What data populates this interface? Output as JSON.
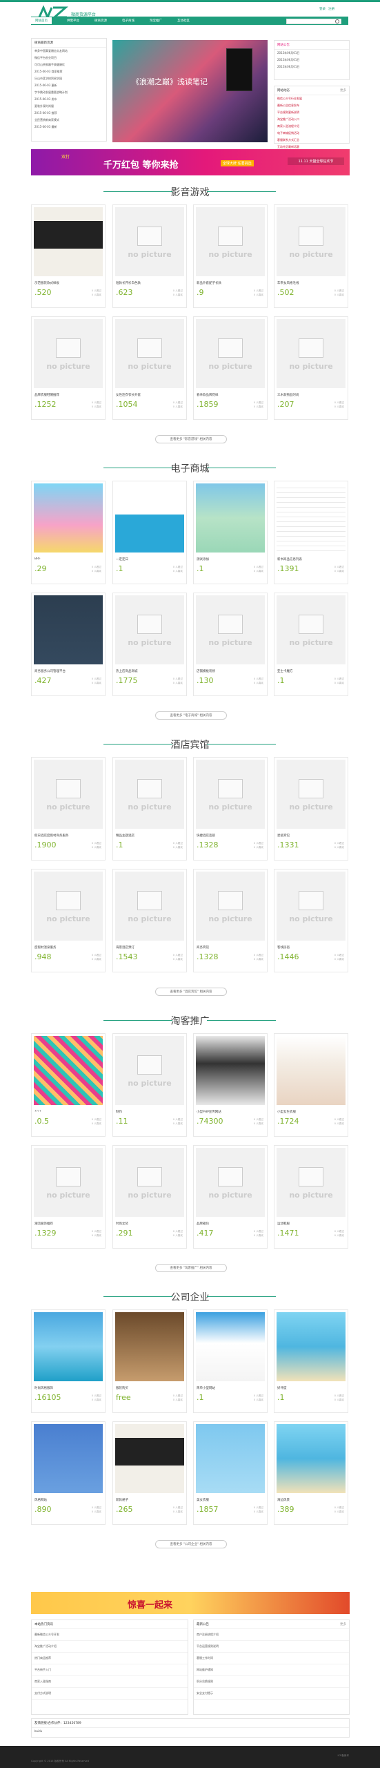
{
  "colors": {
    "brand": "#1e9e7c",
    "price": "#7fb32e",
    "promo_magenta": "#e4197a"
  },
  "header": {
    "logo_text": "微商货源平台",
    "login_label": "登录",
    "register_label": "注册"
  },
  "nav": {
    "items": [
      "网站首页",
      "供需平台",
      "微商货源",
      "电子商城",
      "淘宝推广",
      "互动社区"
    ],
    "active_index": 0,
    "search_placeholder": ""
  },
  "left_news": {
    "title": "微商最新货源",
    "items": [
      {
        "t": "单身中国真爱婚恋交友网站",
        "d": "2015-06-03"
      },
      {
        "t": "微信平台创业项目",
        "d": "2015-06-03"
      },
      {
        "t": "可可山茶鲜嫩手表健康饮",
        "d": "2015-06-03"
      },
      {
        "t": "2015-06-03 商家推荐",
        "d": "2015-06-03"
      },
      {
        "t": "乐山市某学校贸易学园",
        "d": "2015-06-03"
      },
      {
        "t": "2015-06-03 更新",
        "d": "2015-06-03"
      },
      {
        "t": "字节跳动发展重要战略计划",
        "d": "2015-06-03"
      },
      {
        "t": "2015-06-03 发布",
        "d": "2015-06-03"
      },
      {
        "t": "夏装外观时尚服",
        "d": "2015-06-03"
      },
      {
        "t": "2015-06-03 推荐",
        "d": "2015-06-03"
      },
      {
        "t": "全民营销新商家模式",
        "d": "2015-06-03"
      },
      {
        "t": "2015-06-03 最新",
        "d": "2015-06-03"
      }
    ]
  },
  "banner": {
    "text": "《浪潮之巅》浅读笔记"
  },
  "right_top": {
    "title": "网站公告",
    "items": [
      "2015年06月01日",
      "2015年06月01日",
      "2015年06月01日"
    ]
  },
  "right_list": {
    "title": "网站动态",
    "more": "更多",
    "items": [
      "微信公众号行业发展",
      "最新公告信息发布",
      "平台规则更新说明",
      "淘宝推广活动入口",
      "商家入驻流程介绍",
      "电子商城促销活动",
      "客服联系方式汇总",
      "互动社区最新话题"
    ]
  },
  "promo": {
    "left_tag": "双打",
    "main": "千万红包 等你来抢",
    "sub": "全球大牌 任君挑选",
    "right": "11.11 天猫全球狂欢节"
  },
  "sections": [
    {
      "title": "影音游戏",
      "more": "查看更多 \"影音游戏\" 相关内容",
      "rows": [
        [
          {
            "name": "示范服装款式样板",
            "price": ".520",
            "s1": "0 人看过",
            "s2": "0 人喜欢",
            "pic": "dress"
          },
          {
            "name": "短款长开衫白色款",
            "price": ".623",
            "s1": "0 人看过",
            "s2": "0 人喜欢",
            "pic": "none"
          },
          {
            "name": "新品外套配子长款",
            "price": ".9",
            "s1": "0 人看过",
            "s2": "0 人喜欢",
            "pic": "none"
          },
          {
            "name": "车帝女风格毛线",
            "price": ".502",
            "s1": "0 人看过",
            "s2": "0 人喜欢",
            "pic": "none"
          }
        ],
        [
          {
            "name": "品牌衣服鞋帽推荐",
            "price": ".1252",
            "s1": "0 人看过",
            "s2": "0 人喜欢",
            "pic": "none"
          },
          {
            "name": "女性连衣衣长外套",
            "price": ".1054",
            "s1": "0 人看过",
            "s2": "0 人喜欢",
            "pic": "none"
          },
          {
            "name": "春季款品牌花样",
            "price": ".1859",
            "s1": "0 人看过",
            "s2": "0 人喜欢",
            "pic": "none"
          },
          {
            "name": "三木款物品时尚",
            "price": ".207",
            "s1": "0 人看过",
            "s2": "0 人喜欢",
            "pic": "none"
          }
        ]
      ]
    },
    {
      "title": "电子商城",
      "more": "查看更多 \"电子商城\" 相关内容",
      "rows": [
        [
          {
            "name": "BRF",
            "price": ".29",
            "s1": "0 人看过",
            "s2": "0 人喜欢",
            "pic": "cartoon"
          },
          {
            "name": "一定定日",
            "price": ".1",
            "s1": "0 人看过",
            "s2": "0 人喜欢",
            "pic": "logo"
          },
          {
            "name": "测试添加",
            "price": ".1",
            "s1": "0 人看过",
            "s2": "0 人喜欢",
            "pic": "woman"
          },
          {
            "name": "新书商品信息列表",
            "price": ".1391",
            "s1": "0 人看过",
            "s2": "0 人喜欢",
            "pic": "list"
          }
        ],
        [
          {
            "name": "商务服务公司管理平台",
            "price": ".427",
            "s1": "0 人看过",
            "s2": "0 人喜欢",
            "pic": "web"
          },
          {
            "name": "热上店商品商城",
            "price": ".1775",
            "s1": "0 人看过",
            "s2": "0 人喜欢",
            "pic": "none"
          },
          {
            "name": "店铺模板装修",
            "price": ".130",
            "s1": "0 人看过",
            "s2": "0 人喜欢",
            "pic": "none"
          },
          {
            "name": "亚士卡魔方",
            "price": ".1",
            "s1": "0 人看过",
            "s2": "0 人喜欢",
            "pic": "none"
          }
        ]
      ]
    },
    {
      "title": "酒店宾馆",
      "more": "查看更多 \"酒店宾馆\" 相关内容",
      "rows": [
        [
          {
            "name": "假日酒店度假村商务服务",
            "price": ".1900",
            "s1": "0 人看过",
            "s2": "0 人喜欢",
            "pic": "none"
          },
          {
            "name": "精品主题酒店",
            "price": ".1",
            "s1": "0 人看过",
            "s2": "0 人喜欢",
            "pic": "none"
          },
          {
            "name": "快捷酒店连锁",
            "price": ".1328",
            "s1": "0 人看过",
            "s2": "0 人喜欢",
            "pic": "none"
          },
          {
            "name": "星级宾馆",
            "price": ".1331",
            "s1": "0 人看过",
            "s2": "0 人喜欢",
            "pic": "none"
          }
        ],
        [
          {
            "name": "度假村温泉服务",
            "price": ".948",
            "s1": "0 人看过",
            "s2": "0 人喜欢",
            "pic": "none"
          },
          {
            "name": "海景酒店预订",
            "price": ".1543",
            "s1": "0 人看过",
            "s2": "0 人喜欢",
            "pic": "none"
          },
          {
            "name": "商务宾馆",
            "price": ".1328",
            "s1": "0 人看过",
            "s2": "0 人喜欢",
            "pic": "none"
          },
          {
            "name": "客栈民宿",
            "price": ".1446",
            "s1": "0 人看过",
            "s2": "0 人喜欢",
            "pic": "none"
          }
        ]
      ]
    },
    {
      "title": "淘客推广",
      "more": "查看更多 \"淘客推广\" 相关内容",
      "rows": [
        [
          {
            "name": "????",
            "price": ".0.5",
            "s1": "0 人看过",
            "s2": "0 人喜欢",
            "pic": "mosaic"
          },
          {
            "name": "制作",
            "price": ".11",
            "s1": "0 人看过",
            "s2": "0 人喜欢",
            "pic": "none"
          },
          {
            "name": "小型PHP宣传网站",
            "price": ".74300",
            "s1": "0 人看过",
            "s2": "0 人喜欢",
            "pic": "girl"
          },
          {
            "name": "小型女生衣服",
            "price": ".1724",
            "s1": "0 人看过",
            "s2": "0 人喜欢",
            "pic": "shirt"
          }
        ],
        [
          {
            "name": "潮流服饰推荐",
            "price": ".1329",
            "s1": "0 人看过",
            "s2": "0 人喜欢",
            "pic": "none"
          },
          {
            "name": "时尚女装",
            "price": ".291",
            "s1": "0 人看过",
            "s2": "0 人喜欢",
            "pic": "none"
          },
          {
            "name": "品牌箱包",
            "price": ".417",
            "s1": "0 人看过",
            "s2": "0 人喜欢",
            "pic": "none"
          },
          {
            "name": "运动鞋服",
            "price": ".1471",
            "s1": "0 人看过",
            "s2": "0 人喜欢",
            "pic": "none"
          }
        ]
      ]
    },
    {
      "title": "公司企业",
      "more": "查看更多 \"公司企业\" 相关内容",
      "rows": [
        [
          {
            "name": "时尚风格服饰",
            "price": ".16105",
            "s1": "0 人看过",
            "s2": "0 人喜欢",
            "pic": "sea"
          },
          {
            "name": "服装购买",
            "price": "free",
            "s1": "0 人看过",
            "s2": "0 人喜欢",
            "pic": "jenkins"
          },
          {
            "name": "简单小型网站",
            "price": ".1",
            "s1": "0 人看过",
            "s2": "0 人喜欢",
            "pic": "webblue"
          },
          {
            "name": "好评度",
            "price": ".1",
            "s1": "0 人看过",
            "s2": "0 人喜欢",
            "pic": "beach"
          }
        ],
        [
          {
            "name": "风格网站",
            "price": ".890",
            "s1": "0 人看过",
            "s2": "0 人喜欢",
            "pic": "bundler"
          },
          {
            "name": "新款裙子",
            "price": ".265",
            "s1": "0 人看过",
            "s2": "0 人喜欢",
            "pic": "dress"
          },
          {
            "name": "美女衣服",
            "price": ".1857",
            "s1": "0 人看过",
            "s2": "0 人喜欢",
            "pic": "jump"
          },
          {
            "name": "海边风景",
            "price": ".389",
            "s1": "0 人看过",
            "s2": "0 人喜欢",
            "pic": "beach"
          }
        ]
      ]
    }
  ],
  "bottom_banner": {
    "text": "惊喜一起来"
  },
  "bottom_left": {
    "title": "本站热门资讯",
    "items": [
      "最新微信公众号开发",
      "淘宝推广活动介绍",
      "热门商品推荐",
      "平台新手入门",
      "商家入驻指南",
      "支付方式说明"
    ]
  },
  "bottom_right": {
    "title": "最新公告",
    "more": "更多",
    "items": [
      "商户注册流程介绍",
      "平台运营规则说明",
      "客服工作时间",
      "网站维护通知",
      "积分兑换规则",
      "安全支付提示"
    ]
  },
  "links": {
    "title": "友情链接/合作伙伴：123456789",
    "item": "baidu"
  },
  "footer": {
    "copyright": "Copyright © 2015 版权所有 All Rights Reserved",
    "icp": "ICP备案号"
  }
}
